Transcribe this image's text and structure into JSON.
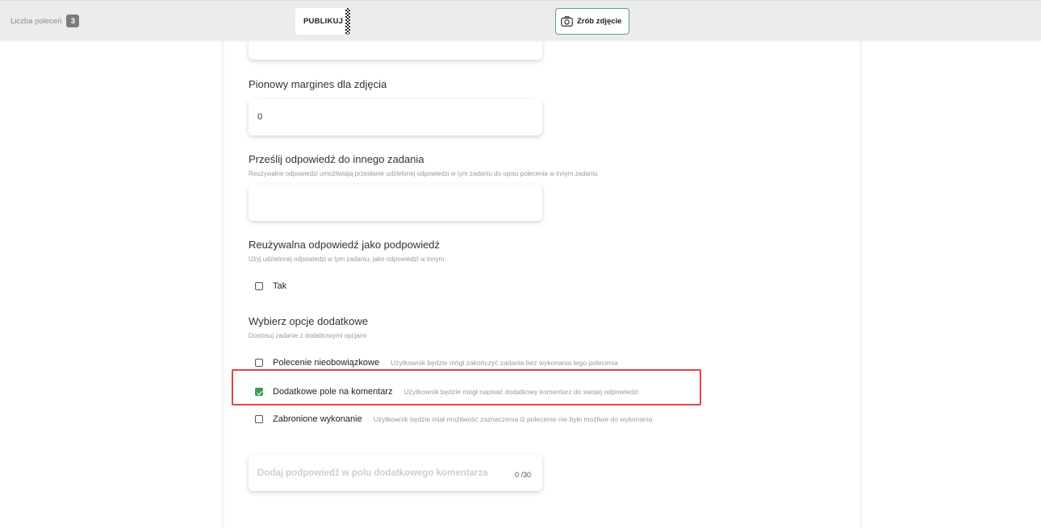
{
  "topbar": {
    "count_label": "Liczba poleceń",
    "count_value": "3",
    "publish_label": "PUBLIKUJ",
    "photo_label": "Zrób zdjęcie",
    "photo_icon": "camera-icon"
  },
  "form": {
    "margin": {
      "label": "Pionowy margines dla zdjęcia",
      "value": "0"
    },
    "forward": {
      "label": "Prześlij odpowiedź do innego zadania",
      "description": "Reużywalne odpowiedzi umożliwiają przesłanie udzielonej odpowiedzi w tym zadaniu do opisu polecenia w innym zadaniu",
      "value": ""
    },
    "reusable": {
      "label": "Reużywalna odpowiedź jako podpowiedź",
      "description": "Użyj udzielonej odpowiedzi w tym zadaniu, jako odpowiedzi w innym",
      "option": {
        "label": "Tak",
        "checked": false
      }
    },
    "extra": {
      "label": "Wybierz opcje dodatkowe",
      "description": "Dostosuj zadanie z dodatkowymi opcjami",
      "options": [
        {
          "label": "Polecenie nieobowiązkowe",
          "description": "Użytkownik będzie mógł zakończyć zadania bez wykonania tego polecenia",
          "checked": false
        },
        {
          "label": "Dodatkowe pole na komentarz",
          "description": "Użytkownik będzie mógł napisać dodatkowy komentarz do swojej odpowiedzi",
          "checked": true
        },
        {
          "label": "Zabronione wykonanie",
          "description": "Użytkownik będzie miał możliwość zaznaczenia iż polecenie nie było możliwe do wykonania",
          "checked": false
        }
      ]
    },
    "comment_hint": {
      "placeholder": "Dodaj podpowiedź w polu dodatkowego komentarza",
      "counter_current": "0",
      "counter_max": "/30"
    }
  },
  "colors": {
    "accent_green": "#3a9b55",
    "highlight_red": "#e04545"
  }
}
